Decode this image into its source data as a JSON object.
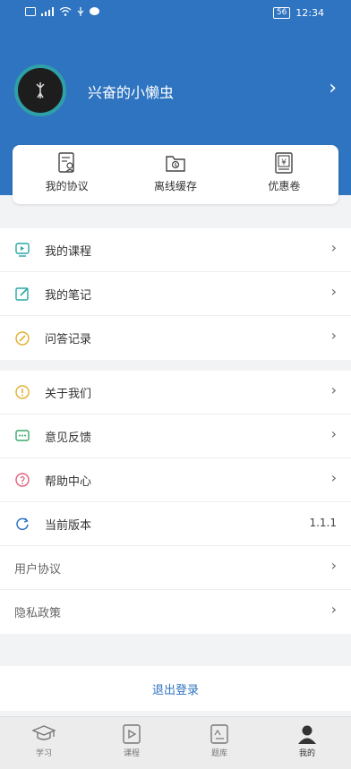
{
  "status": {
    "time": "12:34",
    "battery": "56"
  },
  "profile": {
    "username": "兴奋的小懒虫"
  },
  "quick_actions": [
    {
      "label": "我的协议",
      "icon": "agreement-icon"
    },
    {
      "label": "离线缓存",
      "icon": "offline-cache-icon"
    },
    {
      "label": "优惠卷",
      "icon": "coupon-icon"
    }
  ],
  "menu_group1": [
    {
      "label": "我的课程",
      "icon": "course-icon",
      "color": "#2aa6a6"
    },
    {
      "label": "我的笔记",
      "icon": "note-icon",
      "color": "#2aa6a6"
    },
    {
      "label": "问答记录",
      "icon": "qa-icon",
      "color": "#e0b030"
    }
  ],
  "menu_group2": [
    {
      "label": "关于我们",
      "icon": "info-icon",
      "color": "#e0b030"
    },
    {
      "label": "意见反馈",
      "icon": "feedback-icon",
      "color": "#3aa86a"
    },
    {
      "label": "帮助中心",
      "icon": "help-icon",
      "color": "#e0607a"
    },
    {
      "label": "当前版本",
      "icon": "version-icon",
      "color": "#2f74c0",
      "value": "1.1.1"
    },
    {
      "label": "用户协议"
    },
    {
      "label": "隐私政策"
    }
  ],
  "logout_label": "退出登录",
  "tabs": [
    {
      "label": "学习",
      "icon": "study-icon"
    },
    {
      "label": "课程",
      "icon": "course-play-icon"
    },
    {
      "label": "题库",
      "icon": "question-bank-icon"
    },
    {
      "label": "我的",
      "icon": "profile-icon",
      "active": true
    }
  ],
  "colors": {
    "brand": "#2f74c0",
    "accent_teal": "#2aa6a6"
  }
}
